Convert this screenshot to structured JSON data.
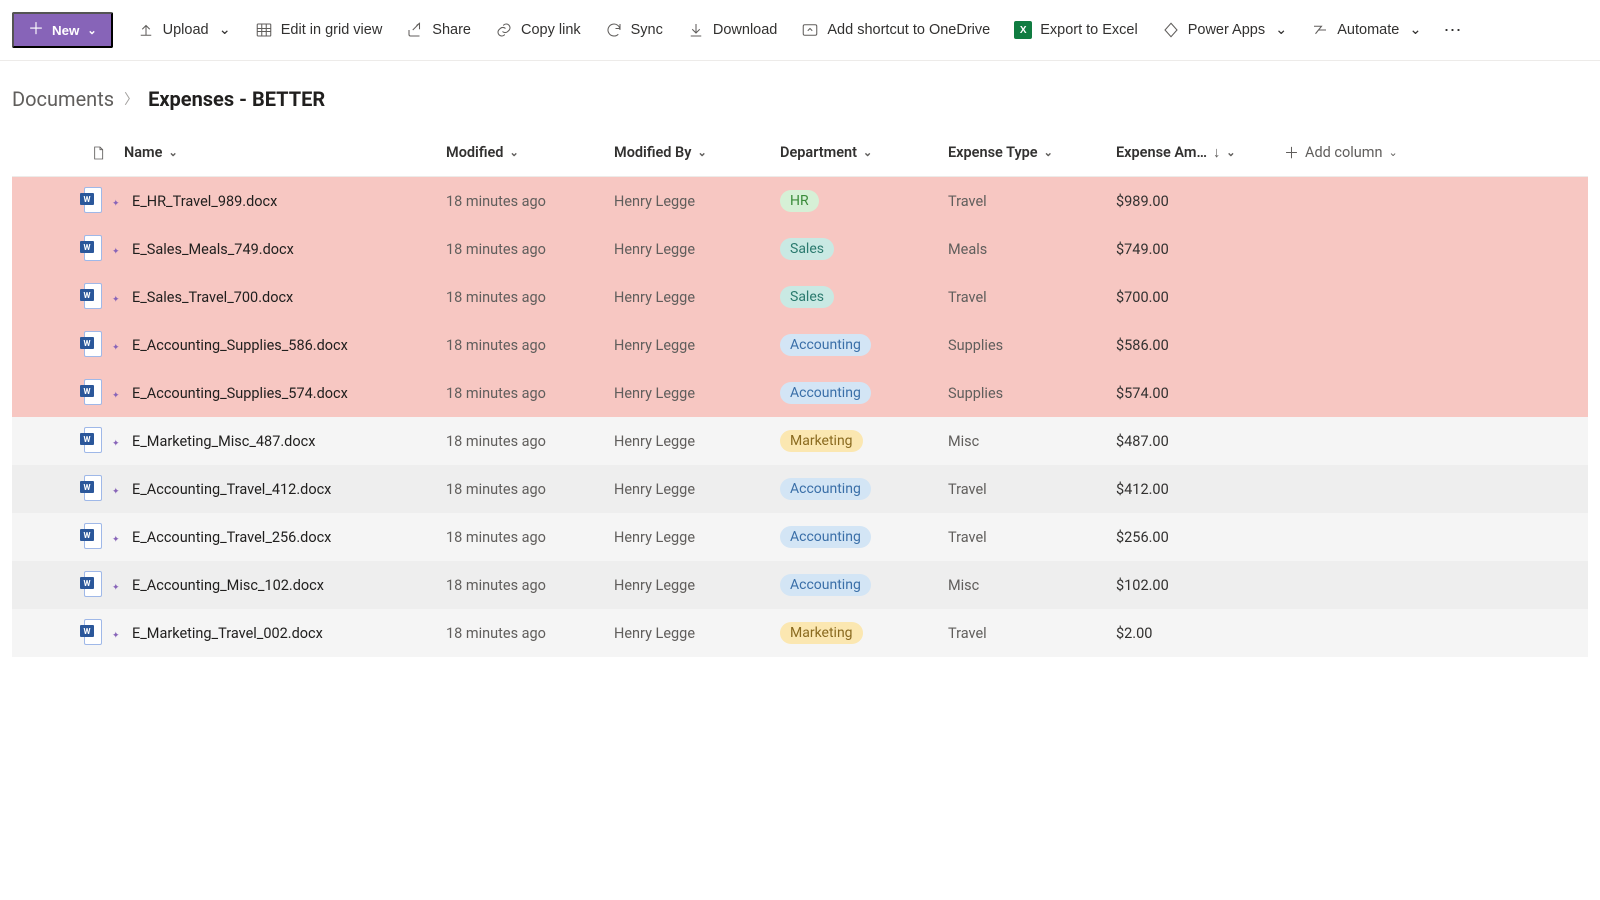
{
  "toolbar": {
    "new": "New",
    "upload": "Upload",
    "edit_grid": "Edit in grid view",
    "share": "Share",
    "copy_link": "Copy link",
    "sync": "Sync",
    "download": "Download",
    "add_shortcut": "Add shortcut to OneDrive",
    "export_excel": "Export to Excel",
    "power_apps": "Power Apps",
    "automate": "Automate"
  },
  "breadcrumb": {
    "root": "Documents",
    "leaf": "Expenses - BETTER"
  },
  "columns": {
    "name": "Name",
    "modified": "Modified",
    "modified_by": "Modified By",
    "department": "Department",
    "expense_type": "Expense Type",
    "expense_amount": "Expense Am…",
    "add_column": "Add column"
  },
  "rows": [
    {
      "name": "E_HR_Travel_989.docx",
      "modified": "18 minutes ago",
      "modified_by": "Henry Legge",
      "department": "HR",
      "dept_class": "hr",
      "expense_type": "Travel",
      "amount": "$989.00",
      "highlight": true
    },
    {
      "name": "E_Sales_Meals_749.docx",
      "modified": "18 minutes ago",
      "modified_by": "Henry Legge",
      "department": "Sales",
      "dept_class": "sales",
      "expense_type": "Meals",
      "amount": "$749.00",
      "highlight": true
    },
    {
      "name": "E_Sales_Travel_700.docx",
      "modified": "18 minutes ago",
      "modified_by": "Henry Legge",
      "department": "Sales",
      "dept_class": "sales",
      "expense_type": "Travel",
      "amount": "$700.00",
      "highlight": true
    },
    {
      "name": "E_Accounting_Supplies_586.docx",
      "modified": "18 minutes ago",
      "modified_by": "Henry Legge",
      "department": "Accounting",
      "dept_class": "accounting",
      "expense_type": "Supplies",
      "amount": "$586.00",
      "highlight": true
    },
    {
      "name": "E_Accounting_Supplies_574.docx",
      "modified": "18 minutes ago",
      "modified_by": "Henry Legge",
      "department": "Accounting",
      "dept_class": "accounting",
      "expense_type": "Supplies",
      "amount": "$574.00",
      "highlight": true
    },
    {
      "name": "E_Marketing_Misc_487.docx",
      "modified": "18 minutes ago",
      "modified_by": "Henry Legge",
      "department": "Marketing",
      "dept_class": "marketing",
      "expense_type": "Misc",
      "amount": "$487.00",
      "highlight": false
    },
    {
      "name": "E_Accounting_Travel_412.docx",
      "modified": "18 minutes ago",
      "modified_by": "Henry Legge",
      "department": "Accounting",
      "dept_class": "accounting",
      "expense_type": "Travel",
      "amount": "$412.00",
      "highlight": false
    },
    {
      "name": "E_Accounting_Travel_256.docx",
      "modified": "18 minutes ago",
      "modified_by": "Henry Legge",
      "department": "Accounting",
      "dept_class": "accounting",
      "expense_type": "Travel",
      "amount": "$256.00",
      "highlight": false
    },
    {
      "name": "E_Accounting_Misc_102.docx",
      "modified": "18 minutes ago",
      "modified_by": "Henry Legge",
      "department": "Accounting",
      "dept_class": "accounting",
      "expense_type": "Misc",
      "amount": "$102.00",
      "highlight": false
    },
    {
      "name": "E_Marketing_Travel_002.docx",
      "modified": "18 minutes ago",
      "modified_by": "Henry Legge",
      "department": "Marketing",
      "dept_class": "marketing",
      "expense_type": "Travel",
      "amount": "$2.00",
      "highlight": false
    }
  ]
}
